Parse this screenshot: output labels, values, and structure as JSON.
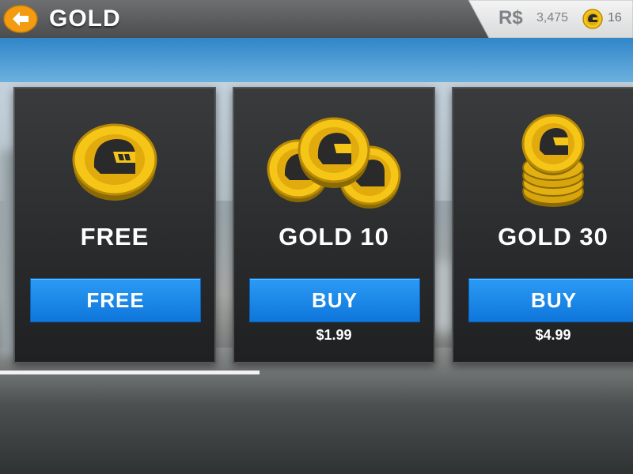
{
  "header": {
    "title": "GOLD",
    "back_icon": "back-arrow-icon",
    "currency_symbol": "R$",
    "rs_amount": "3,475",
    "gold_icon": "gold-helmet-coin-icon",
    "gold_amount": "16"
  },
  "offers": [
    {
      "title": "FREE",
      "button_label": "FREE",
      "price": "",
      "icon": "single-gold-coin-icon"
    },
    {
      "title": "GOLD 10",
      "button_label": "BUY",
      "price": "$1.99",
      "icon": "gold-coin-pile-icon"
    },
    {
      "title": "GOLD 30",
      "button_label": "BUY",
      "price": "$4.99",
      "icon": "gold-coin-stack-icon"
    }
  ],
  "colors": {
    "button_blue": "#1a86e8",
    "back_orange": "#f39c12",
    "gold": "#f1c40f"
  },
  "scroll_progress": 0.41
}
